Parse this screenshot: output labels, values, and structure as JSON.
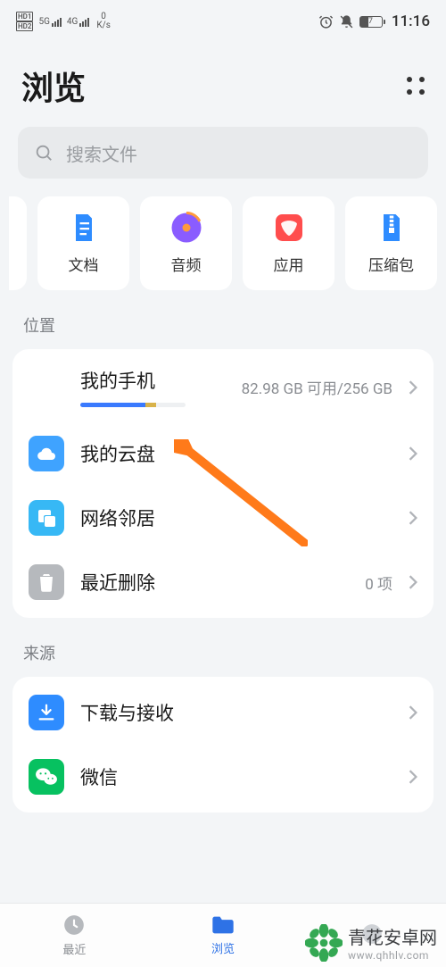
{
  "status": {
    "hd1": "HD1",
    "hd2": "HD2",
    "net1": "5G",
    "net2": "4G",
    "speed_top": "0",
    "speed_bot": "K/s",
    "battery_pct": 37,
    "time": "11:16"
  },
  "header": {
    "title": "浏览"
  },
  "search": {
    "placeholder": "搜索文件"
  },
  "categories": [
    {
      "id": "doc",
      "label": "文档"
    },
    {
      "id": "audio",
      "label": "音频"
    },
    {
      "id": "app",
      "label": "应用"
    },
    {
      "id": "archive",
      "label": "压缩包"
    }
  ],
  "sections": {
    "location_title": "位置",
    "source_title": "来源",
    "location": [
      {
        "id": "myphone",
        "label": "我的手机",
        "right": "82.98 GB 可用/256 GB",
        "icon_bg": "#d7d9dd",
        "has_bar": true
      },
      {
        "id": "cloud",
        "label": "我的云盘",
        "right": "",
        "icon_bg": "#3fa3ff"
      },
      {
        "id": "network",
        "label": "网络邻居",
        "right": "",
        "icon_bg": "#37b8f5"
      },
      {
        "id": "trash",
        "label": "最近删除",
        "right": "0 项",
        "icon_bg": "#b6b9bd"
      }
    ],
    "source": [
      {
        "id": "download",
        "label": "下载与接收",
        "icon_bg": "#2e8cff"
      },
      {
        "id": "wechat",
        "label": "微信",
        "icon_bg": "#07c160"
      }
    ]
  },
  "nav": {
    "recent": "最近",
    "browse": "浏览"
  },
  "watermark": {
    "brand": "青花安卓网",
    "url": "www.qhhlv.com"
  },
  "colors": {
    "accent": "#2e72e6",
    "arrow": "#ff7a1a"
  }
}
